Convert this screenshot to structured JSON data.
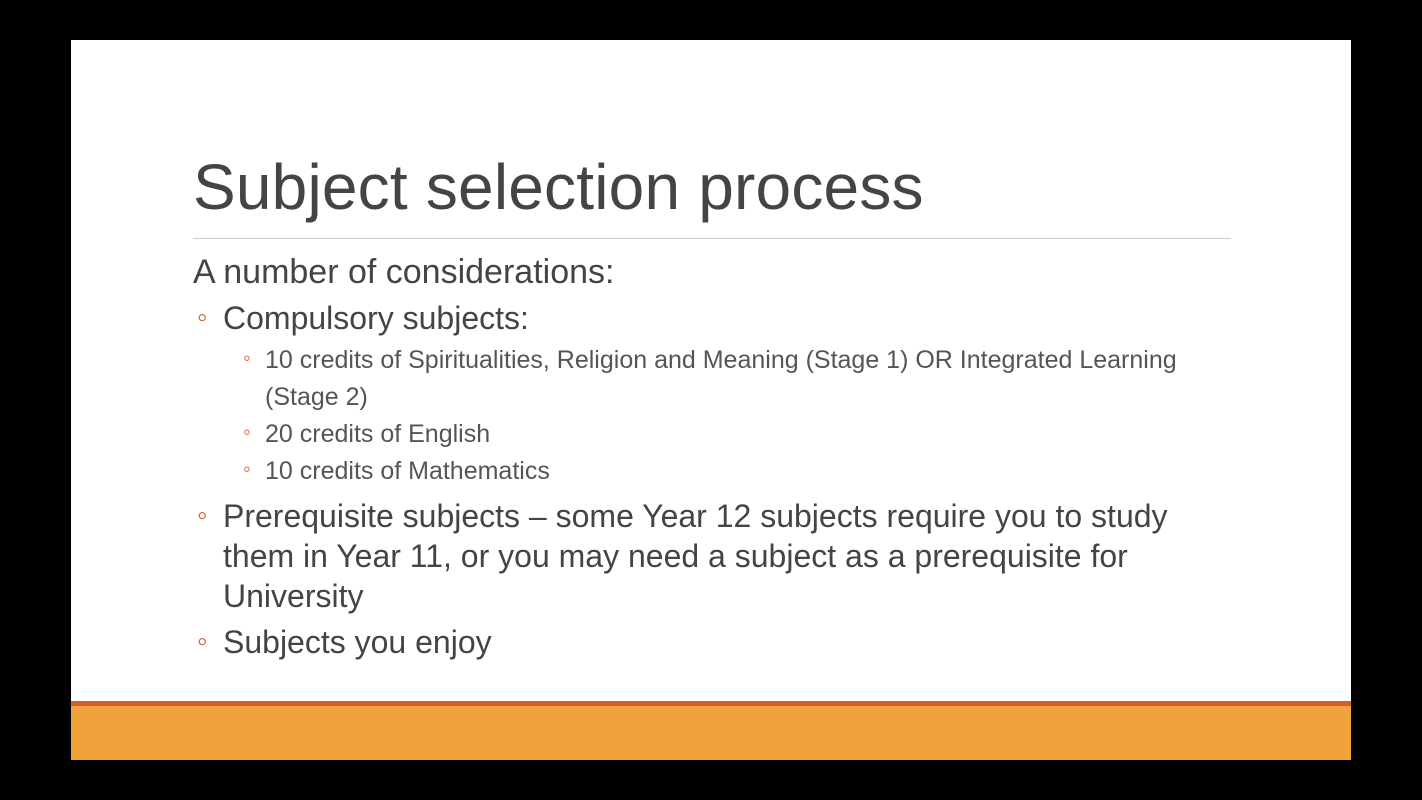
{
  "slide": {
    "title": "Subject selection process",
    "subtitle": "A number of considerations:",
    "bullets": [
      {
        "text": "Compulsory subjects:",
        "children": [
          "10 credits of Spiritualities, Religion and Meaning (Stage 1) OR Integrated Learning (Stage 2)",
          "20 credits of English",
          "10 credits of Mathematics"
        ]
      },
      {
        "text": "Prerequisite subjects – some Year 12 subjects require you to study them in Year 11, or you may need a subject as a prerequisite for University"
      },
      {
        "text": "Subjects you enjoy"
      }
    ]
  },
  "colors": {
    "accent": "#d85c2c",
    "footer": "#efa33a"
  }
}
